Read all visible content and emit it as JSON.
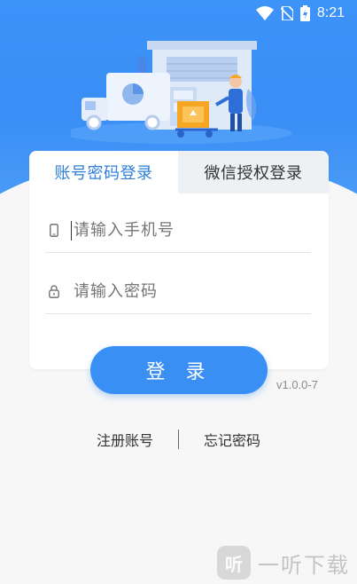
{
  "status_bar": {
    "time": "8:21"
  },
  "tabs": [
    {
      "label": "账号密码登录",
      "active": true
    },
    {
      "label": "微信授权登录",
      "active": false
    }
  ],
  "form": {
    "phone_placeholder": "请输入手机号",
    "password_placeholder": "请输入密码"
  },
  "login_button": "登 录",
  "version": "v1.0.0-7",
  "links": {
    "register": "注册账号",
    "forgot": "忘记密码"
  },
  "watermark": {
    "logo_char": "听",
    "text": "一听下载"
  },
  "colors": {
    "primary": "#3a8ff5",
    "tab_active_text": "#2f7fd8"
  }
}
